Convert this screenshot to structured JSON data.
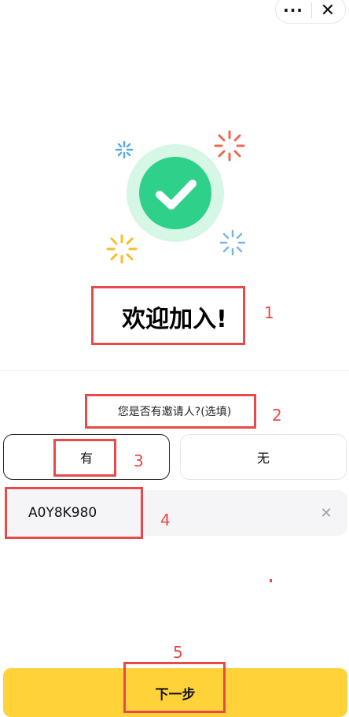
{
  "capsule": {
    "more_icon": "···",
    "close_icon": "✕"
  },
  "welcome": {
    "title": "欢迎加入!"
  },
  "inviter": {
    "question": "您是否有邀请人?(选填)",
    "options": [
      "有",
      "无"
    ],
    "selected": "有",
    "code_value": "A0Y8K980",
    "clear_icon": "✕"
  },
  "next_button": {
    "label": "下一步"
  },
  "annotations": [
    "1",
    "2",
    "3",
    "4",
    "5"
  ],
  "colors": {
    "accent": "#ffd23a",
    "success": "#2ed08a",
    "success_ring": "#d6f6e6",
    "annotation": "#e84a4a"
  }
}
